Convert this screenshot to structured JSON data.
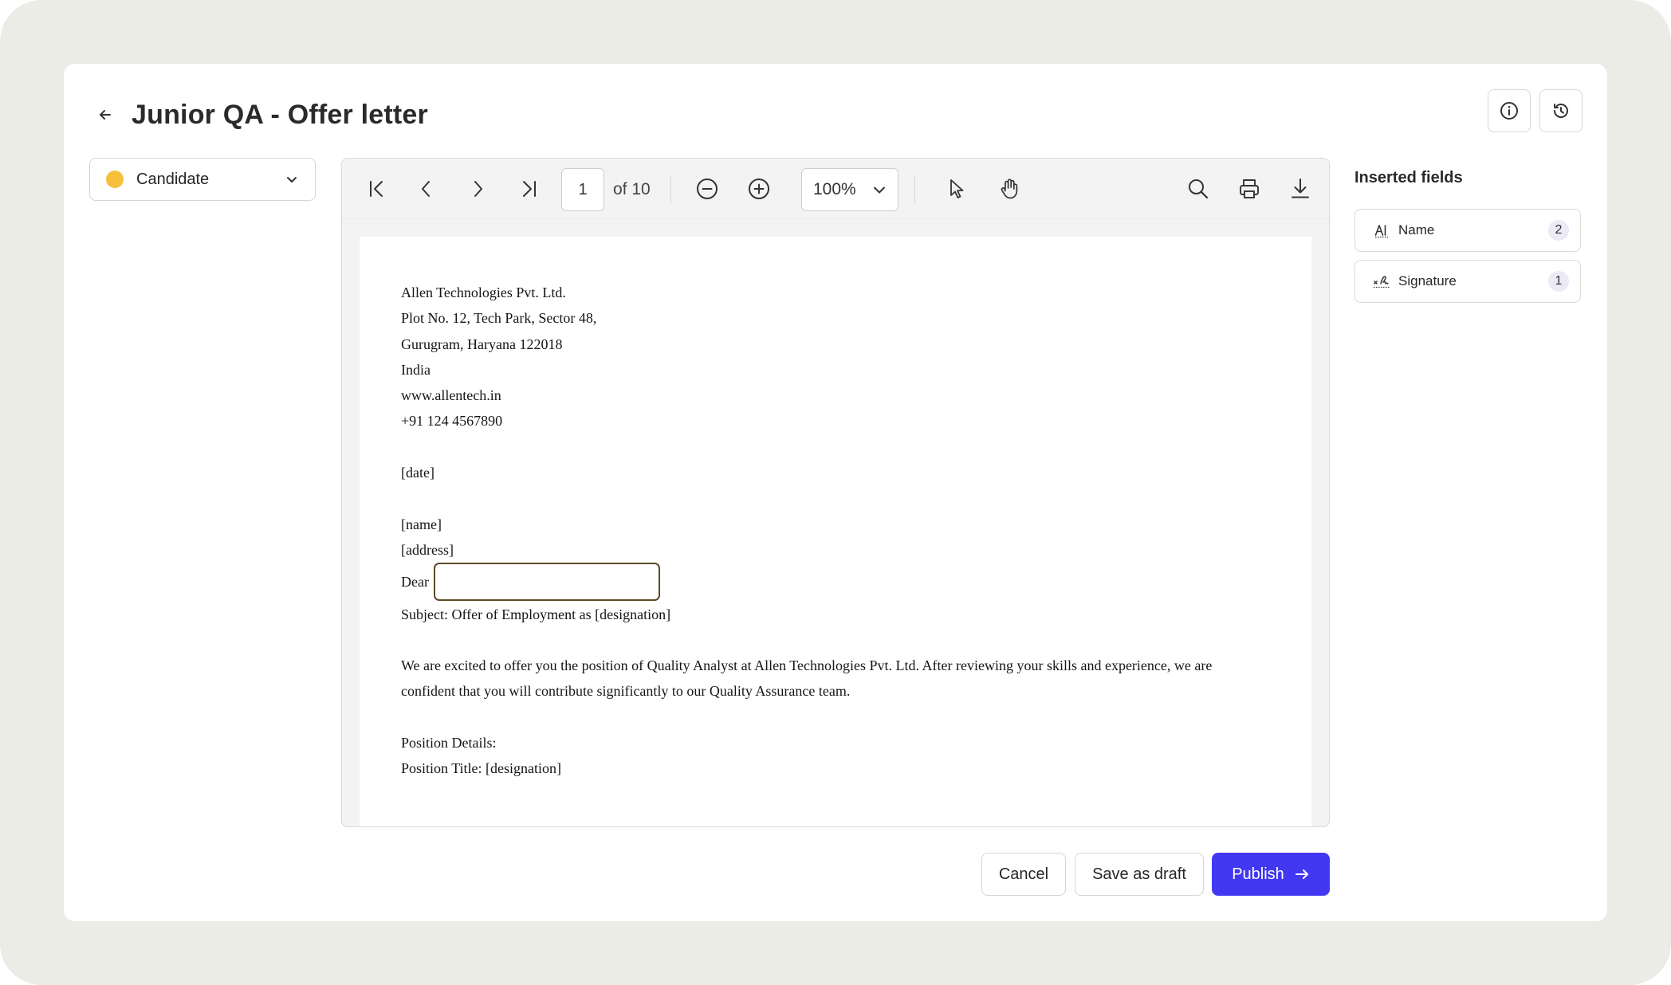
{
  "header": {
    "title": "Junior QA - Offer letter",
    "back_icon": "arrow-left-icon",
    "info_icon": "info-icon",
    "history_icon": "history-icon"
  },
  "role_selector": {
    "label": "Candidate",
    "dot_color": "#f6bf3c"
  },
  "viewer": {
    "current_page": "1",
    "of_label": "of 10",
    "zoom": "100%"
  },
  "letter": {
    "address_lines": [
      "Allen Technologies Pvt. Ltd.",
      "Plot No. 12, Tech Park, Sector 48,",
      "Gurugram, Haryana 122018",
      "India",
      "www.allentech.in",
      "+91 124 4567890"
    ],
    "date": "[date]",
    "name": "[name]",
    "address": "[address]",
    "salutation": "Dear",
    "subject": "Subject: Offer of Employment as [designation]",
    "body_1": "We are excited to offer you the position of Quality Analyst at Allen Technologies Pvt. Ltd. After reviewing your skills and experience, we are",
    "body_2": "confident that you will contribute significantly to our Quality Assurance team.",
    "position_heading": "Position Details:",
    "position_title": "Position Title: [designation]"
  },
  "inserted_fields": {
    "title": "Inserted fields",
    "items": [
      {
        "label": "Name",
        "count": "2",
        "icon": "text-field-icon"
      },
      {
        "label": "Signature",
        "count": "1",
        "icon": "signature-icon"
      }
    ]
  },
  "footer": {
    "cancel": "Cancel",
    "save_draft": "Save as draft",
    "publish": "Publish"
  },
  "colors": {
    "primary": "#4338f2",
    "field_border": "#5e4a26",
    "background": "#ecece6"
  }
}
